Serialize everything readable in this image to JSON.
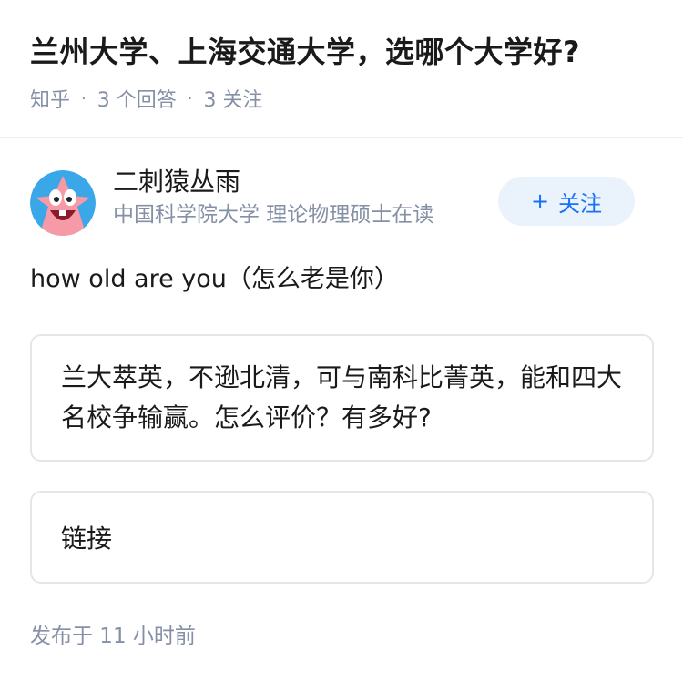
{
  "question": {
    "title": "兰州大学、上海交通大学，选哪个大学好?",
    "source": "知乎",
    "answers_count": "3 个回答",
    "followers_count": "3 关注"
  },
  "author": {
    "name": "二刺猿丛雨",
    "bio": "中国科学院大学 理论物理硕士在读",
    "follow_label": "关注",
    "follow_icon": "plus-icon",
    "avatar": "cartoon-starfish-avatar"
  },
  "answer": {
    "text": "how old are you（怎么老是你）",
    "quote": "兰大萃英，不逊北清，可与南科比菁英，能和四大名校争输赢。怎么评价？有多好?",
    "link_label": "链接",
    "published": "发布于 11 小时前"
  },
  "colors": {
    "accent": "#1772f6",
    "meta": "#8590a6",
    "follow_bg": "#eaf2fc"
  }
}
